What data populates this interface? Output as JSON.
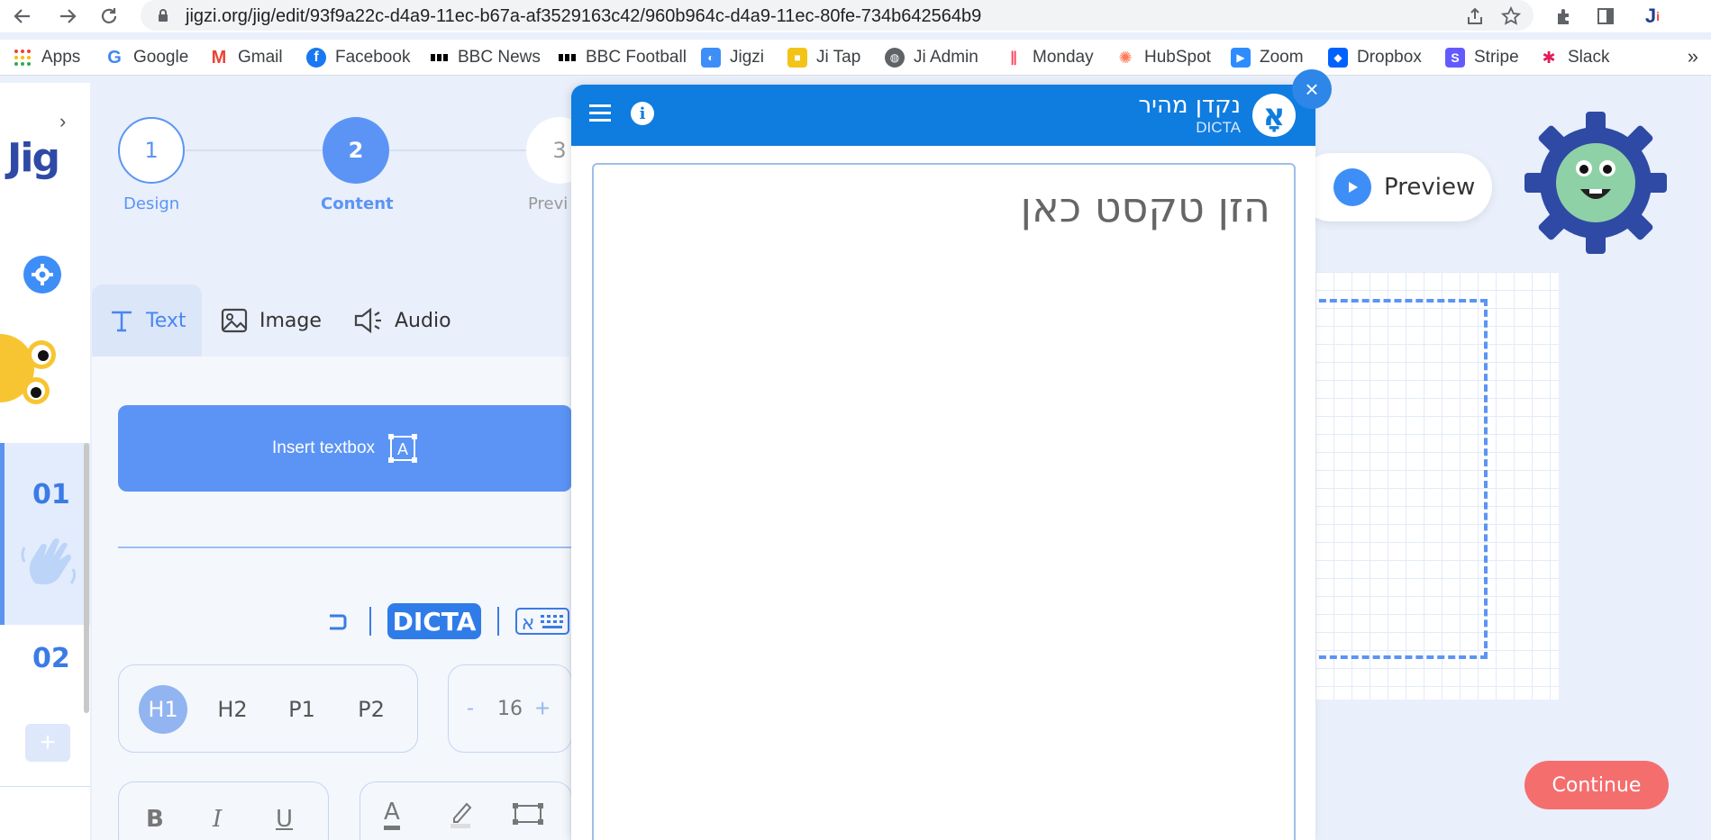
{
  "browser": {
    "url": "jigzi.org/jig/edit/93f9a22c-d4a9-11ec-b67a-af3529163c42/960b964c-d4a9-11ec-80fe-734b642564b9",
    "nav": {
      "back_icon": "arrow-left-icon",
      "forward_icon": "arrow-right-icon",
      "reload_icon": "reload-icon"
    },
    "bookmarks": [
      {
        "label": "Apps",
        "icon": "apps-grid-icon",
        "color": "#ea4335"
      },
      {
        "label": "Google",
        "icon": "google-icon",
        "color": "#4285f4"
      },
      {
        "label": "Gmail",
        "icon": "gmail-icon",
        "color": "#ea4335"
      },
      {
        "label": "Facebook",
        "icon": "facebook-icon",
        "color": "#1877f2"
      },
      {
        "label": "BBC News",
        "icon": "bbc-icon",
        "color": "#000000"
      },
      {
        "label": "BBC Football",
        "icon": "bbc-icon",
        "color": "#000000"
      },
      {
        "label": "Jigzi",
        "icon": "jigzi-icon",
        "color": "#3e8ef7"
      },
      {
        "label": "Ji Tap",
        "icon": "jitap-icon",
        "color": "#f3c318"
      },
      {
        "label": "Ji Admin",
        "icon": "globe-icon",
        "color": "#5f6368"
      },
      {
        "label": "Monday",
        "icon": "monday-icon",
        "color": "#ff3d57"
      },
      {
        "label": "HubSpot",
        "icon": "hubspot-icon",
        "color": "#ff7a59"
      },
      {
        "label": "Zoom",
        "icon": "zoom-icon",
        "color": "#2d8cff"
      },
      {
        "label": "Dropbox",
        "icon": "dropbox-icon",
        "color": "#0061ff"
      },
      {
        "label": "Stripe",
        "icon": "stripe-icon",
        "color": "#635bff"
      },
      {
        "label": "Slack",
        "icon": "slack-icon",
        "color": "#e01e5a"
      }
    ],
    "more": "»"
  },
  "app": {
    "logo": "Jig",
    "slides": [
      "01",
      "02"
    ],
    "add_slide": "+",
    "steps": [
      {
        "number": "1",
        "label": "Design"
      },
      {
        "number": "2",
        "label": "Content"
      },
      {
        "number": "3",
        "label": "Previ"
      }
    ],
    "tabs": {
      "text": "Text",
      "image": "Image",
      "audio": "Audio"
    },
    "insert_textbox": "Insert textbox",
    "dicta_badge": "DICTA",
    "headings": [
      "H1",
      "H2",
      "P1",
      "P2"
    ],
    "font_size": {
      "minus": "-",
      "value": "16",
      "plus": "+"
    },
    "format": {
      "bold": "B",
      "italic": "I",
      "underline": "U",
      "color": "A"
    },
    "preview": "Preview",
    "continue": "Continue"
  },
  "dicta": {
    "title": "נקדן מהיר",
    "subtitle": "DICTA",
    "logo_letter": "אָ",
    "placeholder": "הזן טקסט כאן",
    "close": "×"
  },
  "colors": {
    "accent": "#3e8ef7",
    "dicta_blue": "#0f7ce0",
    "continue": "#f46e6e"
  }
}
